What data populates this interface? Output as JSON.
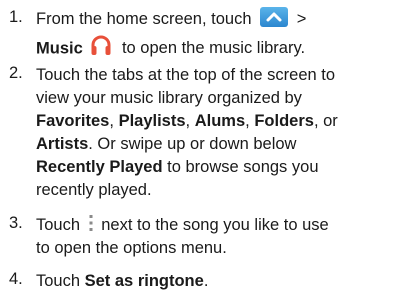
{
  "steps": [
    {
      "num": "1.",
      "l1a": "From the home screen, touch",
      "l1b": ">",
      "l2a": "Music",
      "l2b": "to open the music library."
    },
    {
      "num": "2.",
      "l1": "Touch the tabs at the top of the screen to",
      "l2": "view your music library organized by",
      "l3a": "Favorites",
      "l3b": ",",
      "l3c": "Playlists",
      "l3d": ",",
      "l3e": "Alums",
      "l3f": ",",
      "l3g": "Folders",
      "l3h": ", or",
      "l4a": "Artists",
      "l4b": ". Or swipe up or down below",
      "l5a": "Recently Played",
      "l5b": "to browse songs you",
      "l6": "recently played."
    },
    {
      "num": "3.",
      "l1a": "Touch",
      "l1b": "next to the song you like to use",
      "l2": "to open the options menu."
    },
    {
      "num": "4.",
      "l1a": "Touch",
      "l1b": "Set as ringtone",
      "l1c": "."
    }
  ],
  "icons": {
    "home": "chevron-up-icon",
    "music": "headphones-icon",
    "options": "vertical-dots-menu-icon"
  },
  "colors": {
    "home_icon": "#3a9be0",
    "music_icon": "#e8503a"
  }
}
